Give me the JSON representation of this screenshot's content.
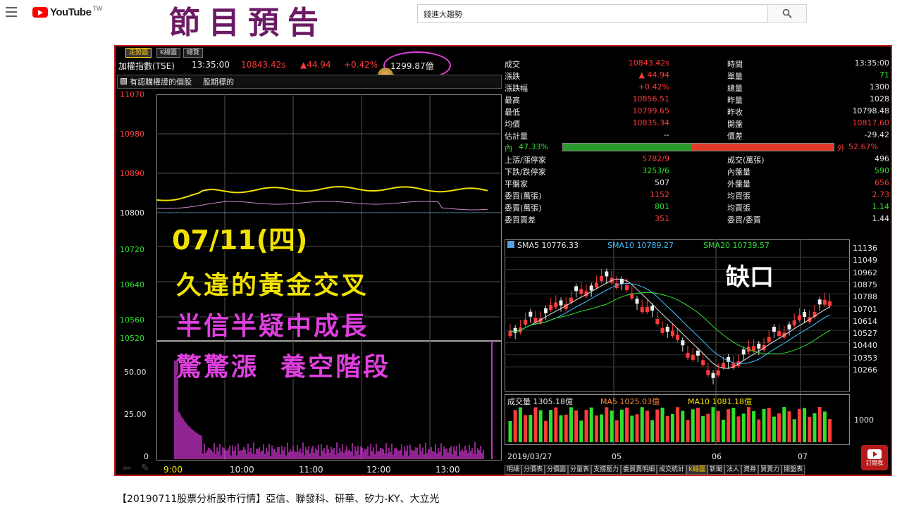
{
  "youtube": {
    "logo_text": "YouTube",
    "region": "TW",
    "search_value": "錢進大趨勢"
  },
  "promo_title": "節目預告",
  "video": {
    "tabs": [
      "走勢圖",
      "K線圖",
      "總覽"
    ],
    "header": {
      "index_name": "加權指數(TSE)",
      "time": "13:35:00",
      "price": "10843.42s",
      "change": "▲44.94",
      "change_pct": "+0.42%",
      "volume": "1299.87億"
    },
    "filter_label": "有認購權證的個股",
    "filter_label2": "股期標的",
    "intraday": {
      "y_ticks": [
        "11070",
        "10980",
        "10890",
        "10800",
        "10720",
        "10640",
        "10560",
        "10520"
      ],
      "vol_ticks": [
        "50.00",
        "25.00",
        "0"
      ],
      "x_ticks": [
        "9:00",
        "10:00",
        "11:00",
        "12:00",
        "13:00"
      ]
    },
    "overlay": {
      "date": "07/11(四)",
      "line1": "久違的黃金交叉",
      "line2": "半信半疑中成長",
      "line3": "驚驚漲  養空階段"
    },
    "quote_left": [
      {
        "label": "成交",
        "value": "10843.42s",
        "color": "red"
      },
      {
        "label": "漲跌",
        "value": "▲ 44.94",
        "color": "red"
      },
      {
        "label": "漲跌幅",
        "value": "+0.42%",
        "color": "red"
      },
      {
        "label": "最高",
        "value": "10856.51",
        "color": "red"
      },
      {
        "label": "最低",
        "value": "10799.65",
        "color": "red"
      },
      {
        "label": "均價",
        "value": "10835.34",
        "color": "red"
      },
      {
        "label": "估計量",
        "value": "--",
        "color": "white"
      }
    ],
    "quote_right": [
      {
        "label": "時間",
        "value": "13:35:00",
        "color": "white"
      },
      {
        "label": "單量",
        "value": "71",
        "color": "green"
      },
      {
        "label": "總量",
        "value": "1300",
        "color": "white"
      },
      {
        "label": "昨量",
        "value": "1028",
        "color": "white"
      },
      {
        "label": "昨收",
        "value": "10798.48",
        "color": "white"
      },
      {
        "label": "開盤",
        "value": "10817.60",
        "color": "red"
      },
      {
        "label": "價差",
        "value": "-29.42",
        "color": "white"
      }
    ],
    "inner_outer": {
      "inner_label": "內",
      "inner_pct": "47.33%",
      "outer_label": "外",
      "outer_pct": "52.67%",
      "inner_fraction": 0.4733
    },
    "breadth_left": [
      {
        "label": "上漲/漲停家",
        "value": "5782/9",
        "color": "red"
      },
      {
        "label": "下跌/跌停家",
        "value": "3253/6",
        "color": "green"
      },
      {
        "label": "平盤家",
        "value": "507",
        "color": "white"
      },
      {
        "label": "委買(萬張)",
        "value": "1152",
        "color": "red"
      },
      {
        "label": "委賣(萬張)",
        "value": "801",
        "color": "green"
      },
      {
        "label": "委買賣差",
        "value": "351",
        "color": "red"
      }
    ],
    "breadth_right": [
      {
        "label": "成交(萬張)",
        "value": "496",
        "color": "white"
      },
      {
        "label": "內盤量",
        "value": "590",
        "color": "green"
      },
      {
        "label": "外盤量",
        "value": "656",
        "color": "red"
      },
      {
        "label": "均買張",
        "value": "2.73",
        "color": "red"
      },
      {
        "label": "均賣張",
        "value": "1.14",
        "color": "green"
      },
      {
        "label": "委買/委賣",
        "value": "1.44",
        "color": "white"
      }
    ],
    "kline": {
      "sma5": "SMA5 10776.33",
      "sma10": "SMA10 10789.27",
      "sma20": "SMA20 10739.57",
      "annotation": "缺口",
      "y_ticks": [
        "11136",
        "11049",
        "10962",
        "10875",
        "10788",
        "10701",
        "10614",
        "10527",
        "10440",
        "10353",
        "10266"
      ],
      "vol_label": "成交量 1305.18億",
      "ma5": "MA5 1025.03億",
      "ma10": "MA10 1081.18億",
      "vol_tick": "1000",
      "x_ticks": [
        "2019/03/27",
        "05",
        "06",
        "07"
      ]
    },
    "bottom_tabs": [
      "明細",
      "分價表",
      "分價圖",
      "分量表",
      "支撐壓力",
      "委買賣明細",
      "成交統計",
      "K線圖",
      "新聞",
      "法人",
      "資券",
      "買賣力",
      "閱盤表"
    ],
    "subscribe_label": "訂閱我"
  },
  "caption": "【20190711股票分析股市行情】亞信、聯發科、研華、矽力-KY、大立光",
  "colors": {
    "accent_red": "#ff3b3b",
    "accent_green": "#2ee02e",
    "yellow": "#f2e200",
    "magenta": "#e040e0",
    "frame": "#c81e1e"
  }
}
